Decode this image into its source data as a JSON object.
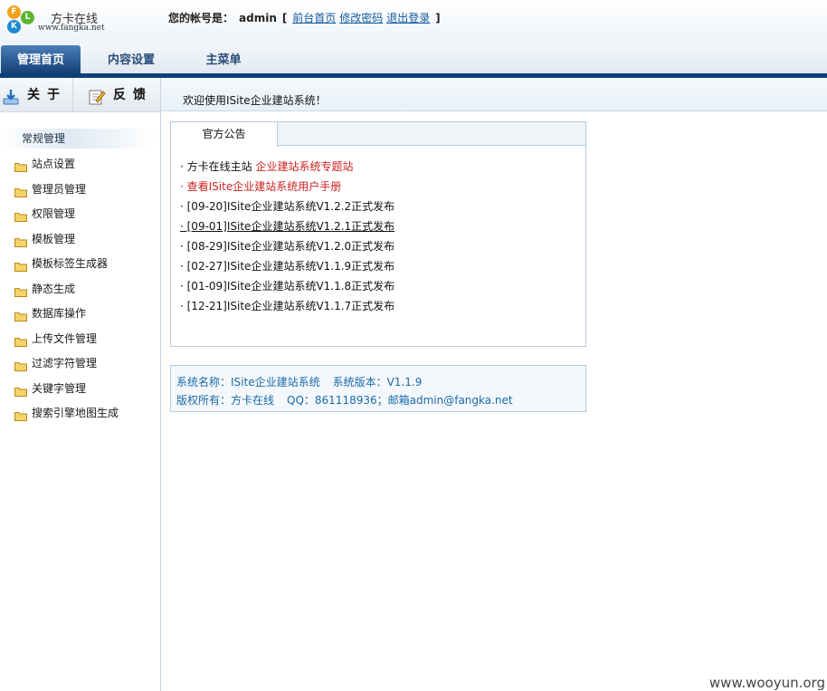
{
  "header": {
    "logo_letters": [
      "F",
      "L",
      "K"
    ],
    "logo_title": "方卡在线",
    "logo_url": "www.fangka.net",
    "account_label": "您的帐号是：",
    "username": "admin",
    "links": [
      "前台首页",
      "修改密码",
      "退出登录"
    ],
    "bracket_open": "[",
    "bracket_close": "]"
  },
  "nav": {
    "tabs": [
      {
        "label": "管理首页",
        "active": true
      },
      {
        "label": "内容设置",
        "active": false
      },
      {
        "label": "主菜单",
        "active": false
      }
    ]
  },
  "sidebar": {
    "buttons": [
      {
        "label": "关于",
        "icon": "download-icon"
      },
      {
        "label": "反馈",
        "icon": "edit-icon"
      }
    ],
    "section_title": "常规管理",
    "items": [
      "站点设置",
      "管理员管理",
      "权限管理",
      "模板管理",
      "模板标签生成器",
      "静态生成",
      "数据库操作",
      "上传文件管理",
      "过滤字符管理",
      "关键字管理",
      "搜索引擎地图生成"
    ]
  },
  "main": {
    "welcome": "欢迎使用ISite企业建站系统！",
    "notice": {
      "tab_label": "官方公告",
      "items": [
        {
          "prefix": "· 方卡在线主站 ",
          "link": "企业建站系统专题站"
        },
        {
          "text": "· 查看ISite企业建站系统用户手册"
        },
        {
          "text": "· [09-20]ISite企业建站系统V1.2.2正式发布"
        },
        {
          "text": "· [09-01]ISite企业建站系统V1.2.1正式发布"
        },
        {
          "text": "· [08-29]ISite企业建站系统V1.2.0正式发布"
        },
        {
          "text": "· [02-27]ISite企业建站系统V1.1.9正式发布"
        },
        {
          "text": "· [01-09]ISite企业建站系统V1.1.8正式发布"
        },
        {
          "text": "· [12-21]ISite企业建站系统V1.1.7正式发布"
        }
      ]
    },
    "info": {
      "system_name": "系统名称：ISite企业建站系统",
      "system_version": "系统版本：V1.1.9",
      "copyright": "版权所有：方卡在线",
      "contact": "QQ：861118936；邮箱admin@fangka.net"
    }
  },
  "watermark": "www.wooyun.org",
  "colors": {
    "nav_dark": "#0f3f78",
    "link_blue": "#135a9c",
    "notice_red": "#cc2222",
    "info_blue": "#1a6aa6",
    "folder_yellow": "#f2c94c"
  }
}
